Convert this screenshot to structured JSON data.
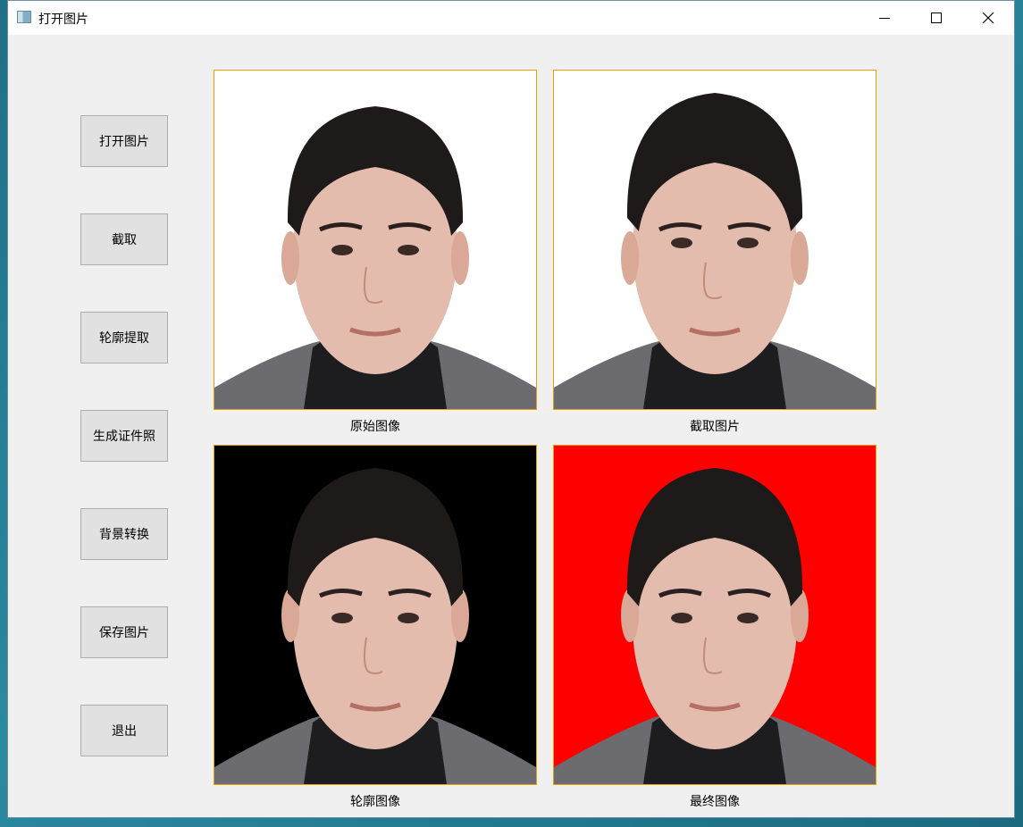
{
  "window": {
    "title": "打开图片",
    "controls": {
      "minimize": "minimize-icon",
      "maximize": "maximize-icon",
      "close": "close-icon"
    }
  },
  "sidebar": {
    "buttons": [
      {
        "label": "打开图片"
      },
      {
        "label": "截取"
      },
      {
        "label": "轮廓提取"
      },
      {
        "label": "生成证件照"
      },
      {
        "label": "背景转换"
      },
      {
        "label": "保存图片"
      },
      {
        "label": "退出"
      }
    ]
  },
  "panels": [
    {
      "caption": "原始图像",
      "background": "#ffffff"
    },
    {
      "caption": "截取图片",
      "background": "#ffffff"
    },
    {
      "caption": "轮廓图像",
      "background": "#000000"
    },
    {
      "caption": "最终图像",
      "background": "#ff0000"
    }
  ],
  "colors": {
    "frame_border": "#e8a000",
    "window_bg": "#f0f0f0",
    "button_bg": "#e1e1e1"
  }
}
